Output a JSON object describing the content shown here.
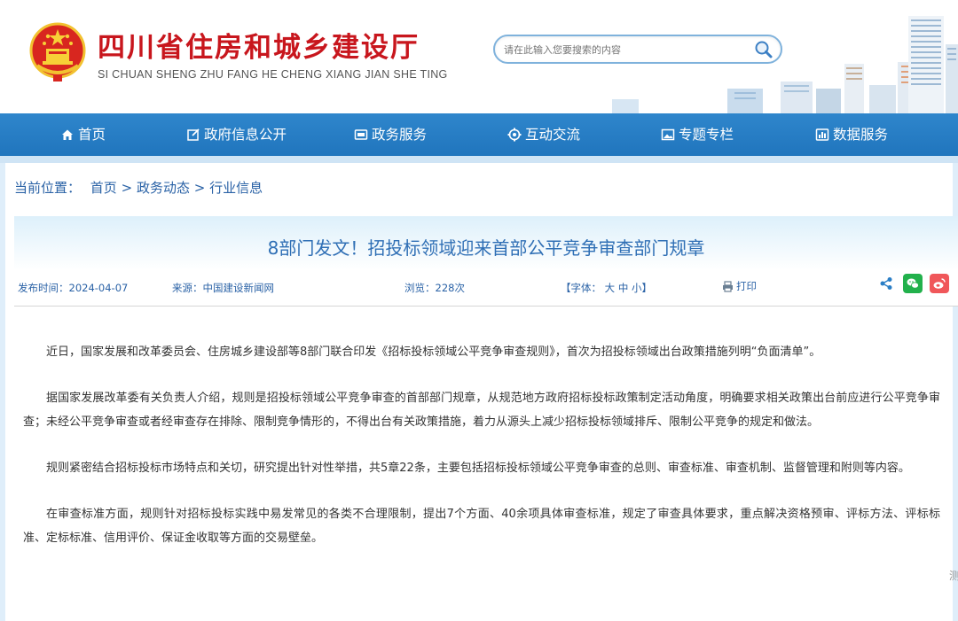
{
  "site": {
    "title": "四川省住房和城乡建设厅",
    "pinyin": "SI CHUAN SHENG ZHU FANG HE CHENG XIANG JIAN SHE TING"
  },
  "search": {
    "placeholder": "请在此输入您要搜索的内容"
  },
  "nav": {
    "items": [
      {
        "label": "首页",
        "icon": "home-icon"
      },
      {
        "label": "政府信息公开",
        "icon": "edit-icon"
      },
      {
        "label": "政务服务",
        "icon": "service-icon"
      },
      {
        "label": "互动交流",
        "icon": "exchange-icon"
      },
      {
        "label": "专题专栏",
        "icon": "image-icon"
      },
      {
        "label": "数据服务",
        "icon": "data-icon"
      }
    ]
  },
  "breadcrumb": {
    "label": "当前位置：",
    "items": [
      "首页",
      "政务动态",
      "行业信息"
    ],
    "separator": ">"
  },
  "article": {
    "title": "8部门发文！招投标领域迎来首部公平竞争审查部门规章",
    "publish_label": "发布时间：",
    "publish_date": "2024-04-07",
    "source_label": "来源：",
    "source": "中国建设新闻网",
    "views_label": "浏览：",
    "views": "228次",
    "font_label_open": "【字体：",
    "font_large": "大",
    "font_medium": "中",
    "font_small": "小",
    "font_label_close": "】",
    "print": "打印",
    "paragraphs": [
      "近日，国家发展和改革委员会、住房城乡建设部等8部门联合印发《招标投标领域公平竞争审查规则》，首次为招投标领域出台政策措施列明“负面清单”。",
      "据国家发展改革委有关负责人介绍，规则是招投标领域公平竞争审查的首部部门规章，从规范地方政府招标投标政策制定活动角度，明确要求相关政策出台前应进行公平竞争审查；未经公平竞争审查或者经审查存在排除、限制竞争情形的，不得出台有关政策措施，着力从源头上减少招标投标领域排斥、限制公平竞争的规定和做法。",
      "规则紧密结合招标投标市场特点和关切，研究提出针对性举措，共5章22条，主要包括招标投标领域公平竞争审查的总则、审查标准、审查机制、监督管理和附则等内容。",
      "在审查标准方面，规则针对招标投标实践中易发常见的各类不合理限制，提出7个方面、40余项具体审查标准，规定了审查具体要求，重点解决资格预审、评标方法、评标标准、定标标准、信用评价、保证金收取等方面的交易壁垒。"
    ]
  },
  "side_tab": "测",
  "colors": {
    "brand_red": "#c8161d",
    "nav_blue": "#2a7ec6",
    "link_blue": "#2a62a6",
    "wechat_green": "#22b14c",
    "weibo_red": "#f0575a"
  }
}
